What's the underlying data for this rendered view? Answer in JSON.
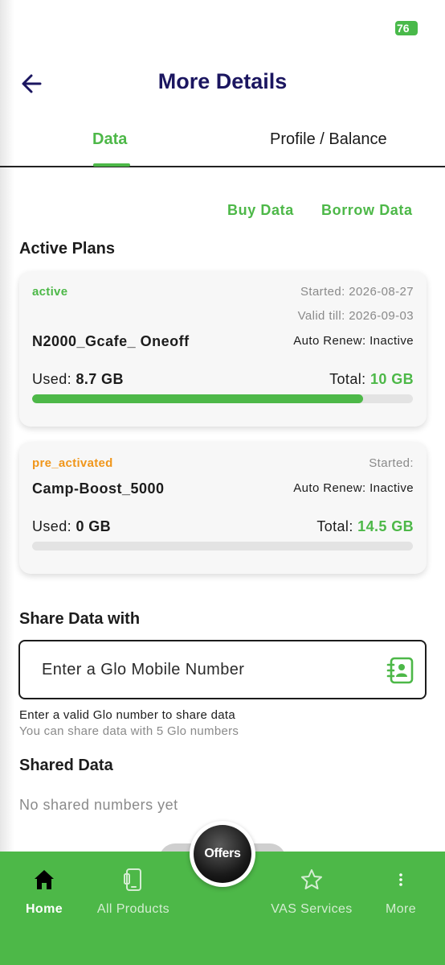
{
  "status_bar": {
    "battery": "76"
  },
  "header": {
    "title": "More Details"
  },
  "tabs": [
    {
      "label": "Data",
      "active": true
    },
    {
      "label": "Profile / Balance",
      "active": false
    }
  ],
  "actions": {
    "buy_data": "Buy Data",
    "borrow_data": "Borrow Data"
  },
  "active_plans": {
    "title": "Active Plans",
    "plans": [
      {
        "status": "active",
        "started": "Started: 2026-08-27",
        "valid_till": "Valid till: 2026-09-03",
        "name": "N2000_Gcafe_ Oneoff",
        "auto_renew": "Auto Renew: Inactive",
        "used_label": "Used:",
        "used_value": "8.7 GB",
        "total_label": "Total:",
        "total_value": "10 GB",
        "progress_fraction": 0.87
      },
      {
        "status": "pre_activated",
        "started": "Started:",
        "name": "Camp-Boost_5000",
        "auto_renew": "Auto Renew: Inactive",
        "used_label": "Used:",
        "used_value": "0 GB",
        "total_label": "Total:",
        "total_value": "14.5 GB",
        "progress_fraction": 0
      }
    ]
  },
  "share": {
    "title": "Share Data with",
    "placeholder": "Enter a Glo Mobile Number",
    "hint": "Enter a valid Glo number to share data",
    "limit_note": "You can share data with 5 Glo numbers"
  },
  "shared": {
    "title": "Shared Data",
    "empty": "No shared numbers yet"
  },
  "bottom_nav": {
    "offers": "Offers",
    "items": [
      {
        "label": "Home",
        "icon": "home-icon"
      },
      {
        "label": "All Products",
        "icon": "phone-icon"
      },
      {
        "label": "VAS Services",
        "icon": "star-icon"
      },
      {
        "label": "More",
        "icon": "more-vertical-icon"
      }
    ]
  },
  "colors": {
    "accent": "#4db848",
    "title": "#1b1660",
    "pending": "#f0961b"
  }
}
